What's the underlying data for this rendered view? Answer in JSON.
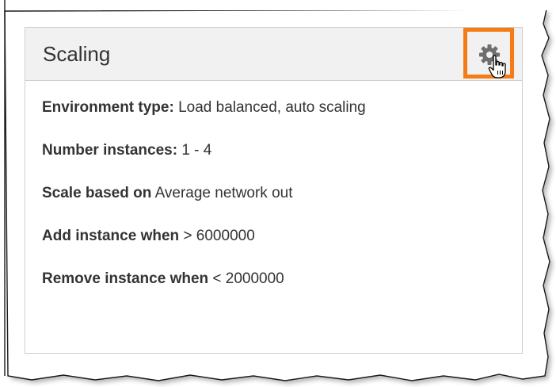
{
  "panel": {
    "title": "Scaling"
  },
  "fields": [
    {
      "label": "Environment type:",
      "value": "Load balanced, auto scaling"
    },
    {
      "label": "Number instances:",
      "value": "1 - 4"
    },
    {
      "label": "Scale based on",
      "value": "Average network out"
    },
    {
      "label": "Add instance when",
      "value": "> 6000000"
    },
    {
      "label": "Remove instance when",
      "value": "< 2000000"
    }
  ],
  "icons": {
    "settings": "gear-icon",
    "cursor": "hand-pointer-icon"
  },
  "colors": {
    "highlight": "#f47b16",
    "header_bg": "#f1f1f1",
    "border": "#cfcfcf",
    "text": "#333333"
  }
}
